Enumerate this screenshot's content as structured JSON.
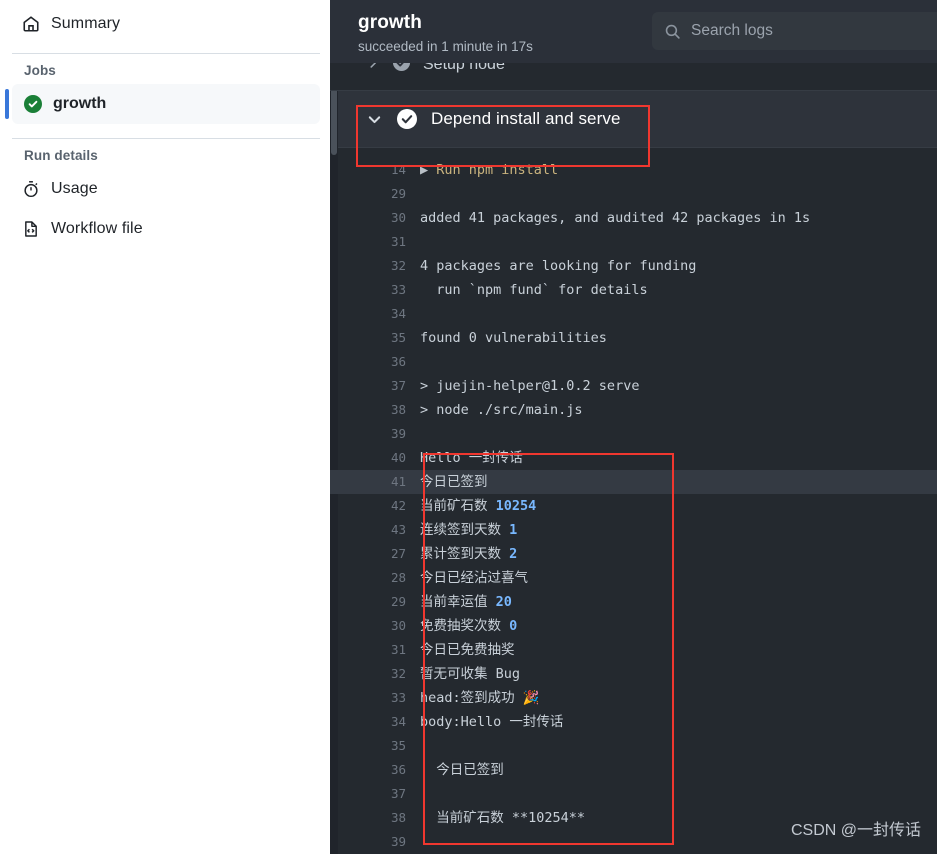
{
  "sidebar": {
    "summary": {
      "label": "Summary",
      "icon": "home-icon"
    },
    "jobs_section_title": "Jobs",
    "job": {
      "label": "growth",
      "status_icon": "check-circle-green-icon"
    },
    "run_details_title": "Run details",
    "run_details": [
      {
        "label": "Usage",
        "icon": "stopwatch-icon"
      },
      {
        "label": "Workflow file",
        "icon": "code-file-icon"
      }
    ]
  },
  "log_header": {
    "title": "growth",
    "subtitle": "succeeded in 1 minute in 17s",
    "search": {
      "placeholder": "Search logs",
      "value": "",
      "icon": "search-icon"
    }
  },
  "steps": {
    "clipped_above": {
      "label": "Setup node",
      "chevron": "chevron-right-icon",
      "status_icon": "check-circle-icon"
    },
    "current": {
      "label": "Depend install and serve",
      "chevron": "chevron-down-icon",
      "status_icon": "check-circle-white-icon",
      "expanded": true
    }
  },
  "log_lines": [
    {
      "n": "14",
      "text": "▶ Run npm install",
      "style": "cmd",
      "hl": false
    },
    {
      "n": "29",
      "text": "",
      "style": "plain",
      "hl": false
    },
    {
      "n": "30",
      "text": "added 41 packages, and audited 42 packages in 1s",
      "style": "plain",
      "hl": false
    },
    {
      "n": "31",
      "text": "",
      "style": "plain",
      "hl": false
    },
    {
      "n": "32",
      "text": "4 packages are looking for funding",
      "style": "plain",
      "hl": false
    },
    {
      "n": "33",
      "text": "  run `npm fund` for details",
      "style": "plain",
      "hl": false
    },
    {
      "n": "34",
      "text": "",
      "style": "plain",
      "hl": false
    },
    {
      "n": "35",
      "text": "found 0 vulnerabilities",
      "style": "plain",
      "hl": false
    },
    {
      "n": "36",
      "text": "",
      "style": "plain",
      "hl": false
    },
    {
      "n": "37",
      "text": "> juejin-helper@1.0.2 serve",
      "style": "plain",
      "hl": false
    },
    {
      "n": "38",
      "text": "> node ./src/main.js",
      "style": "plain",
      "hl": false
    },
    {
      "n": "39",
      "text": "",
      "style": "plain",
      "hl": false
    },
    {
      "n": "40",
      "text": "Hello 一封传话",
      "style": "plain",
      "hl": false
    },
    {
      "n": "41",
      "text": "今日已签到",
      "style": "plain",
      "hl": true
    },
    {
      "n": "42",
      "text": "当前矿石数 ",
      "suffix_num": "10254",
      "style": "num",
      "hl": false
    },
    {
      "n": "43",
      "text": "连续签到天数 ",
      "suffix_num": "1",
      "style": "num",
      "hl": false
    },
    {
      "n": "27",
      "text": "累计签到天数 ",
      "suffix_num": "2",
      "style": "num",
      "hl": false
    },
    {
      "n": "28",
      "text": "今日已经沾过喜气",
      "style": "plain",
      "hl": false
    },
    {
      "n": "29",
      "text": "当前幸运值 ",
      "suffix_num": "20",
      "style": "num",
      "hl": false
    },
    {
      "n": "30",
      "text": "免费抽奖次数 ",
      "suffix_num": "0",
      "style": "num",
      "hl": false
    },
    {
      "n": "31",
      "text": "今日已免费抽奖",
      "style": "plain",
      "hl": false
    },
    {
      "n": "32",
      "text": "暂无可收集 Bug",
      "style": "plain",
      "hl": false
    },
    {
      "n": "33",
      "text": "head:签到成功 🎉",
      "style": "plain",
      "hl": false
    },
    {
      "n": "34",
      "text": "body:Hello 一封传话",
      "style": "plain",
      "hl": false
    },
    {
      "n": "35",
      "text": "",
      "style": "plain",
      "hl": false
    },
    {
      "n": "36",
      "text": "  今日已签到",
      "style": "plain",
      "hl": false
    },
    {
      "n": "37",
      "text": "",
      "style": "plain",
      "hl": false
    },
    {
      "n": "38",
      "text": "  当前矿石数 **10254**",
      "style": "plain",
      "hl": false
    },
    {
      "n": "39",
      "text": "",
      "style": "plain",
      "hl": false
    }
  ],
  "annotations": {
    "box_step_color": "#f0372f",
    "box_logs_color": "#f0372f"
  },
  "watermark": {
    "text": "CSDN @一封传话"
  },
  "colors": {
    "log_bg": "#24292f",
    "header_bg": "#2b3039",
    "step_bg": "#2e333b",
    "accent_blue": "#3977d9",
    "status_green": "#1a7f37",
    "cmd_tan": "#c9b37e",
    "number_blue": "#79b8ff"
  }
}
